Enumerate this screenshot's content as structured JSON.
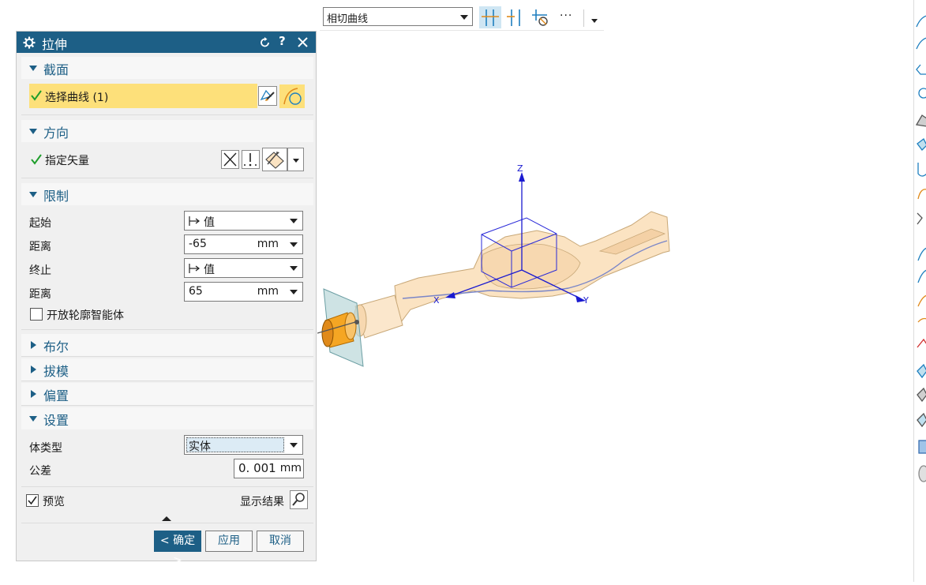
{
  "toolbar": {
    "curve_rule": "相切曲线",
    "more_label": "···"
  },
  "dialog": {
    "title": "拉伸",
    "sections": {
      "section": {
        "label": "截面",
        "select_curve": "选择曲线 (1)"
      },
      "direction": {
        "label": "方向",
        "specify_vector": "指定矢量"
      },
      "limits": {
        "label": "限制",
        "start_label": "起始",
        "start_value": "值",
        "start_distance_label": "距离",
        "start_distance": "-65",
        "end_label": "终止",
        "end_value": "值",
        "end_distance_label": "距离",
        "end_distance": "65",
        "unit": "mm",
        "open_profile": "开放轮廓智能体"
      },
      "boolean": {
        "label": "布尔"
      },
      "draft": {
        "label": "拔模"
      },
      "offset": {
        "label": "偏置"
      },
      "settings": {
        "label": "设置",
        "body_type_label": "体类型",
        "body_type": "实体",
        "tolerance_label": "公差",
        "tolerance": "0. 001",
        "tolerance_unit": "mm"
      }
    },
    "preview_label": "预览",
    "show_result": "显示结果",
    "buttons": {
      "ok": "< 确定 >",
      "apply": "应用",
      "cancel": "取消"
    }
  },
  "viewport": {
    "axis_z": "Z",
    "axis_x": "X",
    "axis_y": "Y"
  },
  "colors": {
    "accent": "#1d5f86",
    "selection_highlight": "#fde07a",
    "part_fill": "#fbe3c2"
  }
}
